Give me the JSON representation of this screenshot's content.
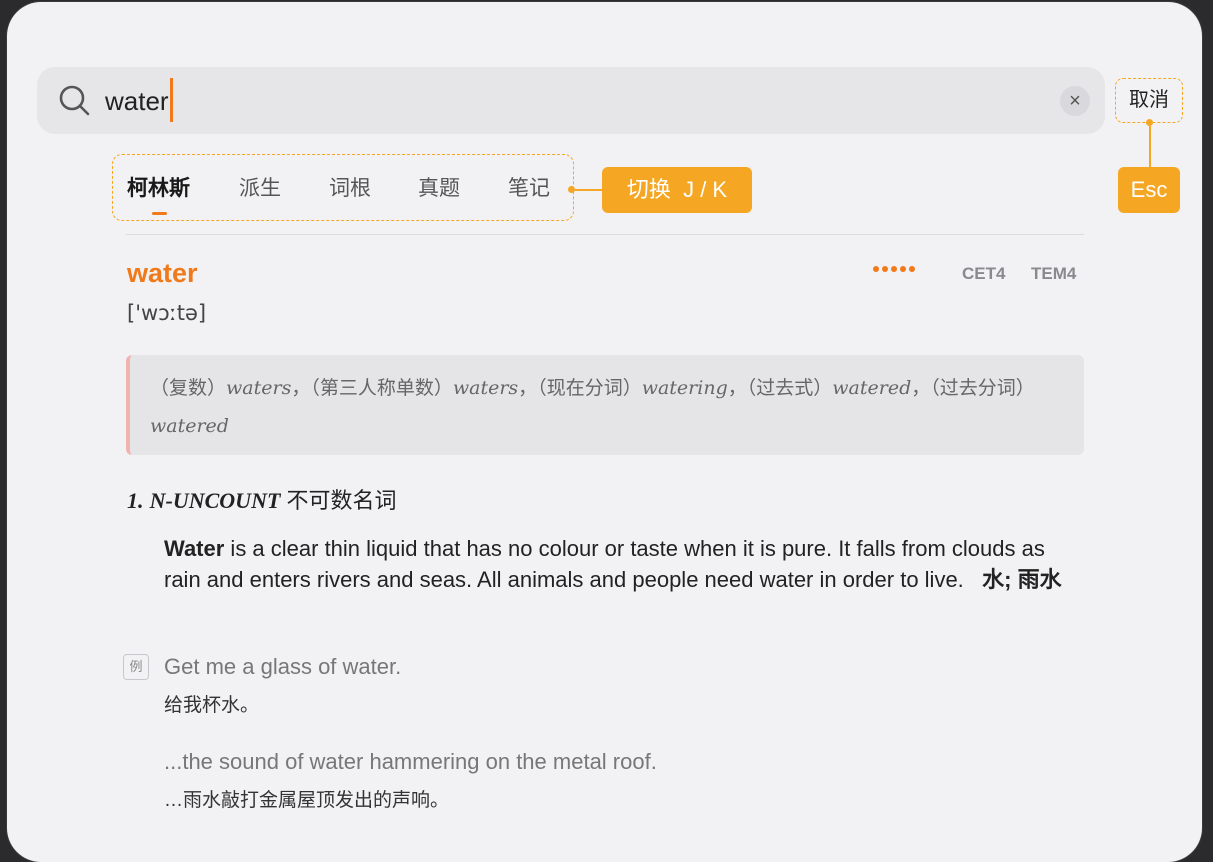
{
  "search": {
    "query": "water",
    "cancel_label": "取消"
  },
  "shortcuts": {
    "switch_label": "切换  J / K",
    "esc_label": "Esc"
  },
  "tabs": [
    {
      "label": "柯林斯",
      "active": true
    },
    {
      "label": "派生",
      "active": false
    },
    {
      "label": "词根",
      "active": false
    },
    {
      "label": "真题",
      "active": false
    },
    {
      "label": "笔记",
      "active": false
    }
  ],
  "entry": {
    "headword": "water",
    "frequency_stars": 5,
    "levels": [
      "CET4",
      "TEM4"
    ],
    "phonetic": "['wɔːtə]",
    "inflections": [
      {
        "label": "（复数）",
        "form": "waters"
      },
      {
        "label": "（第三人称单数）",
        "form": "waters"
      },
      {
        "label": "（现在分词）",
        "form": "watering"
      },
      {
        "label": "（过去式）",
        "form": "watered"
      },
      {
        "label": "（过去分词）",
        "form": "watered"
      }
    ],
    "sense": {
      "number": "1.",
      "pos": "N-UNCOUNT",
      "pos_zh": "不可数名词",
      "def_word": "Water",
      "def_text": " is a clear thin liquid that has no colour or taste when it is pure. It falls from clouds as rain and enters rivers and seas. All animals and people need water in order to live.",
      "def_zh": "水; 雨水",
      "example_tag": "例",
      "examples": [
        {
          "en": "Get me a glass of water.",
          "zh": "给我杯水。"
        },
        {
          "en": "...the sound of water hammering on the metal roof.",
          "zh": "…雨水敲打金属屋顶发出的声响。"
        }
      ]
    }
  },
  "colors": {
    "accent": "#f07a1a",
    "annotation": "#f5a623",
    "panel": "#f2f2f4"
  }
}
